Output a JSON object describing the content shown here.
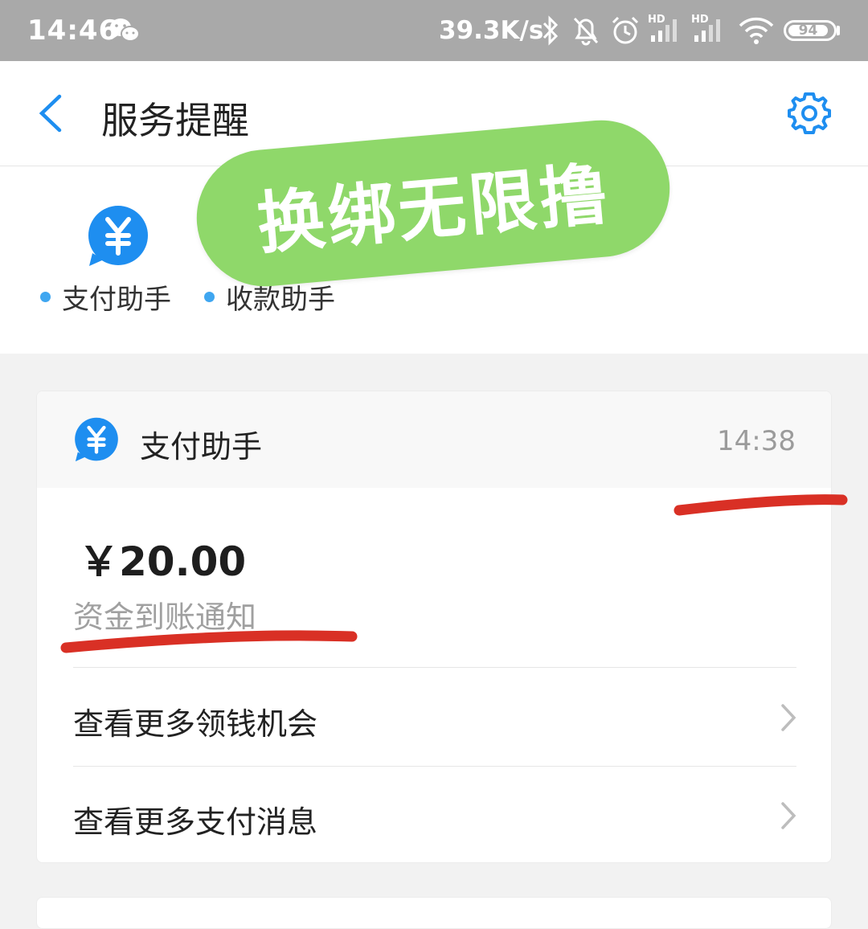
{
  "status_bar": {
    "time": "14:46",
    "net_speed": "39.3K/s",
    "hd1": "HD",
    "hd2": "HD",
    "battery": "94",
    "icons": [
      "wechat-icon",
      "bluetooth-icon",
      "mute-bell-icon",
      "alarm-icon",
      "signal-hd-icon",
      "signal-hd-icon",
      "wifi-icon",
      "battery-icon"
    ]
  },
  "header": {
    "title": "服务提醒",
    "back_icon": "chevron-left-icon",
    "settings_icon": "gear-icon"
  },
  "tabs": [
    {
      "label": "支付助手"
    },
    {
      "label": "收款助手"
    }
  ],
  "watermark": {
    "text": "换绑无限撸"
  },
  "card": {
    "sender": "支付助手",
    "time": "14:38",
    "amount": "￥20.00",
    "subtitle": "资金到账通知",
    "links": [
      {
        "label": "查看更多领钱机会"
      },
      {
        "label": "查看更多支付消息"
      }
    ]
  },
  "colors": {
    "accent_blue": "#1e8ef0",
    "status_bar": "#a9a9a9",
    "watermark_green": "#8fd86a",
    "annotation_red": "#d93025"
  }
}
